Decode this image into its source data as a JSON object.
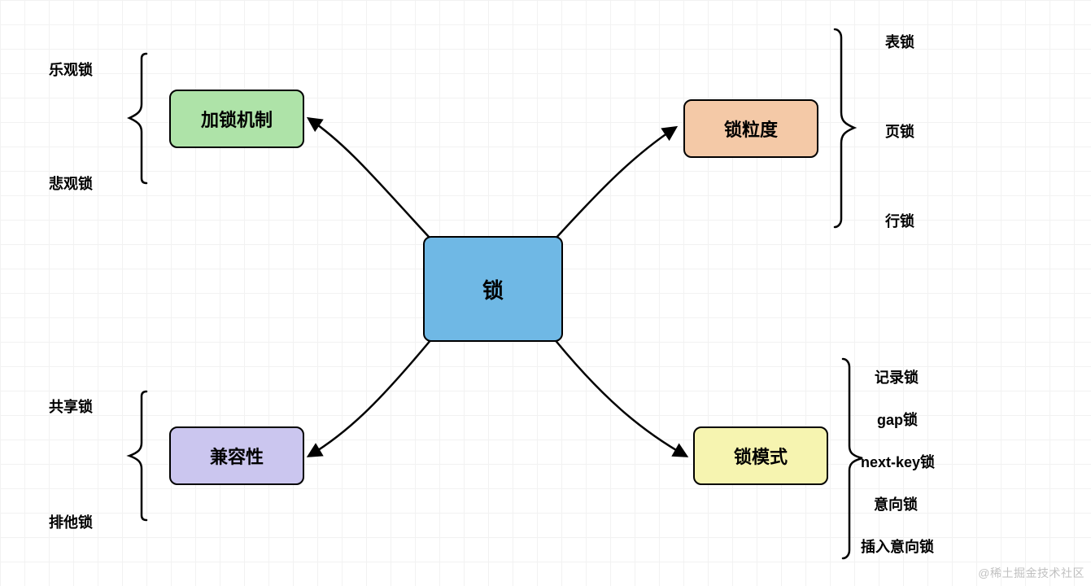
{
  "center": {
    "label": "锁"
  },
  "branches": {
    "topLeft": {
      "label": "加锁机制",
      "leaves": [
        "乐观锁",
        "悲观锁"
      ]
    },
    "topRight": {
      "label": "锁粒度",
      "leaves": [
        "表锁",
        "页锁",
        "行锁"
      ]
    },
    "bottomLeft": {
      "label": "兼容性",
      "leaves": [
        "共享锁",
        "排他锁"
      ]
    },
    "bottomRight": {
      "label": "锁模式",
      "leaves": [
        "记录锁",
        "gap锁",
        "next-key锁",
        "意向锁",
        "插入意向锁"
      ]
    }
  },
  "colors": {
    "center": "#6fb8e5",
    "topLeft": "#aee3a8",
    "topRight": "#f4c9a7",
    "bottomLeft": "#cbc6ef",
    "bottomRight": "#f6f4b0"
  },
  "watermark": "@稀土掘金技术社区"
}
